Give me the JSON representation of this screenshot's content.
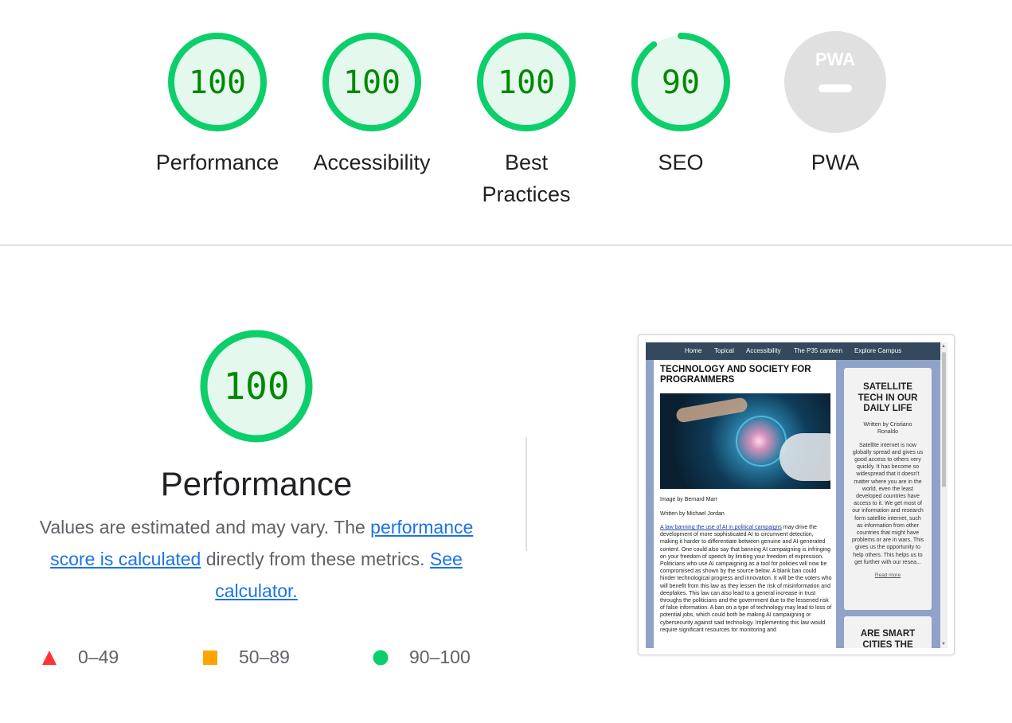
{
  "gauges": [
    {
      "label": "Performance",
      "score": "100",
      "value": 100
    },
    {
      "label": "Accessibility",
      "score": "100",
      "value": 100
    },
    {
      "label": "Best Practices",
      "score": "100",
      "value": 100
    },
    {
      "label": "SEO",
      "score": "90",
      "value": 90
    },
    {
      "label": "PWA",
      "badge": "PWA"
    }
  ],
  "colors": {
    "pass": "#0cce6b",
    "pass_fill": "#e5f8ee",
    "score_text": "#008800",
    "average": "#ffa400",
    "fail": "#ff3333",
    "na": "#e0e0e0",
    "link": "#1a73e8"
  },
  "performance": {
    "score": "100",
    "title": "Performance",
    "desc_prefix": "Values are estimated and may vary. The ",
    "desc_link1": "performance score is calculated",
    "desc_middle": " directly from these metrics. ",
    "desc_link2": "See calculator."
  },
  "legend": [
    {
      "range": "0–49",
      "icon": "triangle-icon"
    },
    {
      "range": "50–89",
      "icon": "square-icon"
    },
    {
      "range": "90–100",
      "icon": "circle-icon"
    }
  ],
  "screenshot": {
    "nav": [
      "Home",
      "Topical",
      "Accessibility",
      "The P35 canteen",
      "Explore Campus"
    ],
    "heading": "TECHNOLOGY AND SOCIETY FOR PROGRAMMERS",
    "image_credit": "Image by Bernard Marr",
    "author": "Written by Michael Jordan",
    "article_link": "A law banning the use of AI in political campaigns",
    "article_text": " may drive the development of more sophisticated AI to circumvent detection, making it harder to differentiate between genuine and AI-generated content. One could also say that banning AI campaigning is infringing on your freedom of speech by limiting your freedom of expression. Politicians who use AI campaigning as a tool for policies will now be compromised as shown by the source below. A blank ban could hinder technological progress and innovation. It will be the voters who will benefit from this law as they lessen the risk of misinformation and deepfakes. This law can also lead to a general increase in trust throughs the politicians and the government due to the lessened risk of false information. A ban on a type of technology may lead to loss of potential jobs, which could both be making AI campaigning or cybersecurity against said technology. Implementing this law would require significant resources for monitoring and",
    "sidebar_title": "SATELLITE TECH IN OUR DAILY LIFE",
    "sidebar_author": "Written by Cristiano Ronaldo",
    "sidebar_text": "Satellite internet is now globally spread and gives us good access to others very quickly. It has become so widespread that it doesn't matter where you are in the world, even the least developed countries have access to it. We get most of our information and research form satellite internet, such as information from other countries that might have problems or are in wars. This gives us the opportunity to help others. This helps us to get further with our resea...",
    "sidebar_more": "Read more",
    "sidebar2_title": "ARE SMART CITIES THE"
  }
}
